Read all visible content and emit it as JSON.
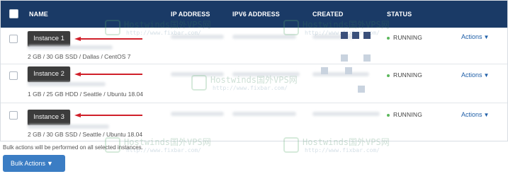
{
  "table": {
    "columns": [
      "NAME",
      "IP ADDRESS",
      "IPV6 ADDRESS",
      "CREATED",
      "STATUS"
    ],
    "rows": [
      {
        "badge": "Instance 1",
        "spec": "2 GB / 30 GB SSD / Dallas / CentOS 7",
        "status": "RUNNING",
        "actions": "Actions"
      },
      {
        "badge": "Instance 2",
        "spec": "1 GB / 25 GB HDD / Seattle / Ubuntu 18.04",
        "status": "RUNNING",
        "actions": "Actions"
      },
      {
        "badge": "Instance 3",
        "spec": "2 GB / 30 GB SSD / Seattle / Ubuntu 18.04",
        "status": "RUNNING",
        "actions": "Actions"
      }
    ]
  },
  "footer": {
    "note": "Bulk actions will be performed on all selected instances.",
    "bulk_label": "Bulk Actions"
  },
  "watermark": {
    "brand": "Hostwinds国外VPS网",
    "url": "http://www.fixbar.com/"
  },
  "icons": {
    "chevron": "chevron-down-icon",
    "arrow": "red-arrow-annotation"
  },
  "colors": {
    "header_bg": "#1a3a66",
    "arrow": "#d0202a",
    "running_dot": "#5cb85c",
    "link": "#1f5fa8",
    "button": "#3b7dc4"
  }
}
